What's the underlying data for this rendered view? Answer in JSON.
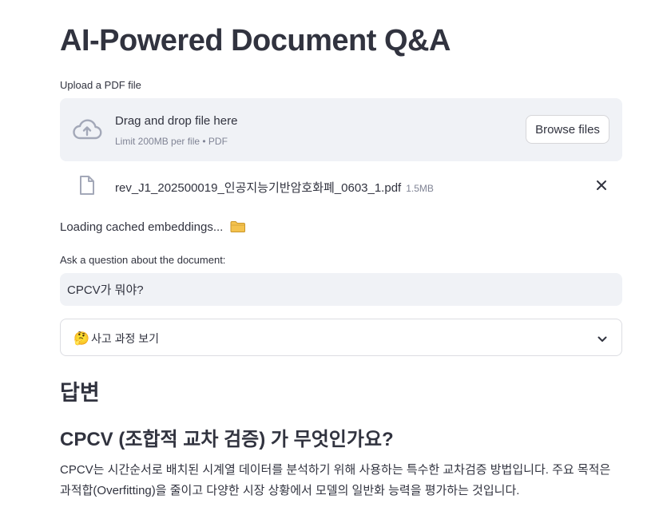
{
  "page": {
    "title": "AI-Powered Document Q&A"
  },
  "uploader": {
    "label": "Upload a PDF file",
    "drop_text": "Drag and drop file here",
    "limit_text": "Limit 200MB per file • PDF",
    "browse_label": "Browse files",
    "icon": "cloud-upload-icon"
  },
  "uploaded_file": {
    "name": "rev_J1_202500019_인공지능기반암호화폐_0603_1.pdf",
    "size": "1.5MB",
    "icon": "file-icon",
    "remove_icon": "close-icon"
  },
  "status": {
    "text": "Loading cached embeddings...",
    "icon": "folder-icon"
  },
  "question": {
    "label": "Ask a question about the document:",
    "value": "CPCV가 뭐야?"
  },
  "expander": {
    "emoji": "🤔",
    "label": "사고 과정 보기",
    "icon": "chevron-down-icon"
  },
  "answer": {
    "heading": "답변",
    "subheading": "CPCV (조합적 교차 검증) 가 무엇인가요?",
    "body": "CPCV는 시간순서로 배치된 시계열 데이터를 분석하기 위해 사용하는 특수한 교차검증 방법입니다. 주요 목적은 과적합(Overfitting)을 줄이고 다양한 시장 상황에서 모델의 일반화 능력을 평가하는 것입니다."
  },
  "colors": {
    "text": "#31333f",
    "muted": "#808495",
    "panel": "#f0f2f6",
    "border": "#d6d6d9"
  }
}
